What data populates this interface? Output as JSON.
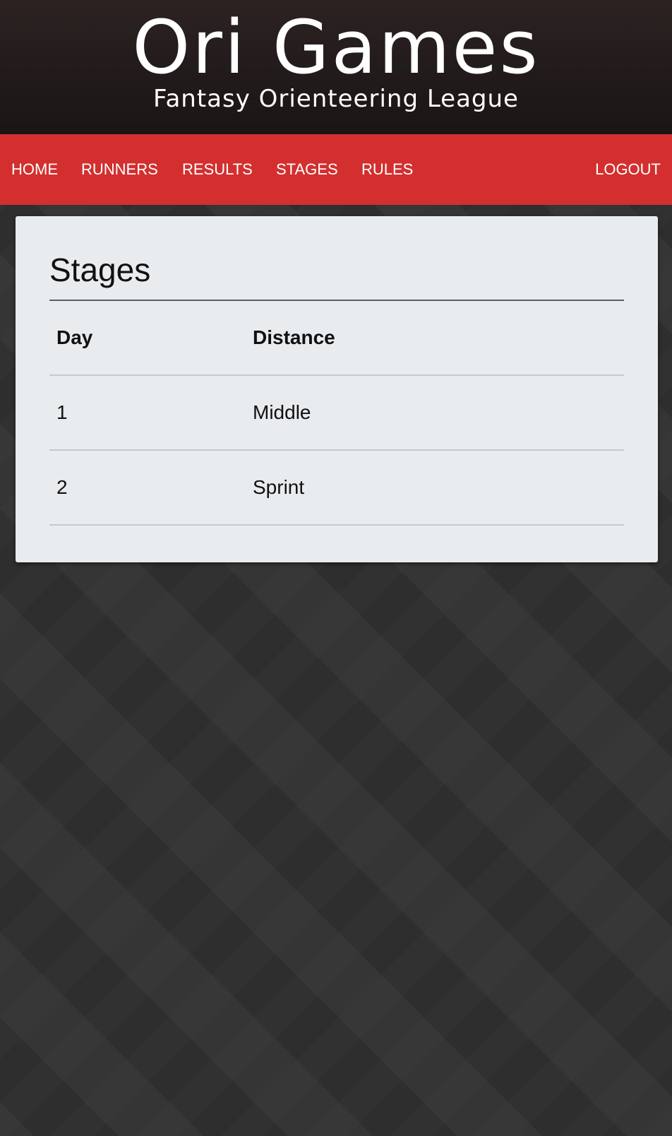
{
  "header": {
    "title": "Ori Games",
    "subtitle": "Fantasy Orienteering League"
  },
  "nav": {
    "home": "HOME",
    "runners": "RUNNERS",
    "results": "RESULTS",
    "stages": "STAGES",
    "rules": "RULES",
    "logout": "LOGOUT"
  },
  "colors": {
    "nav_background": "#d32f2f",
    "card_background": "#e8ecef",
    "page_background": "#313131"
  },
  "main": {
    "title": "Stages",
    "table": {
      "headers": [
        "Day",
        "Distance"
      ],
      "rows": [
        [
          "1",
          "Middle"
        ],
        [
          "2",
          "Sprint"
        ]
      ]
    }
  }
}
